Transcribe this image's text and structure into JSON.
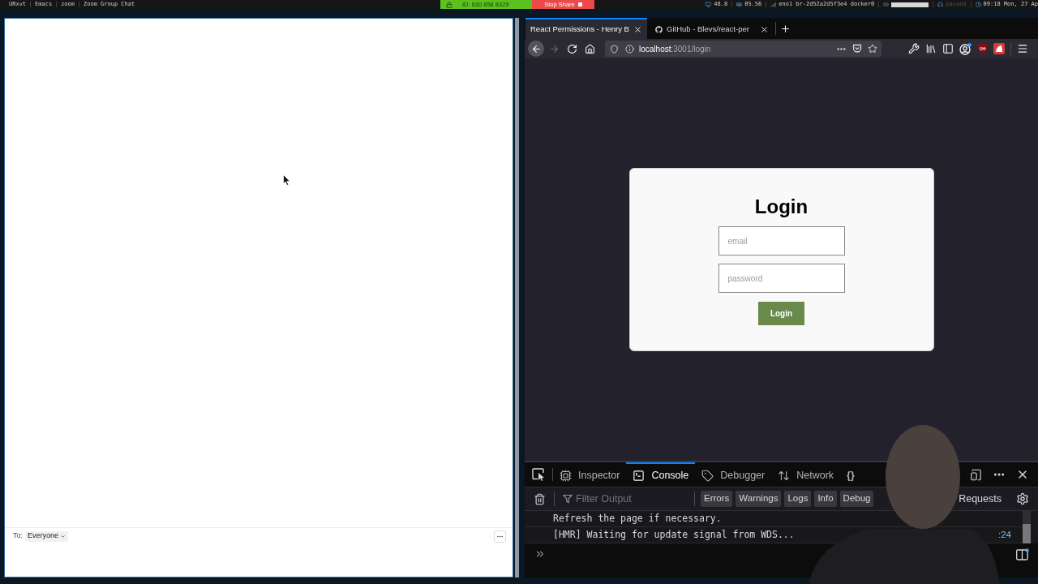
{
  "top_bar": {
    "workspaces": [
      "URxvt",
      "Emacs",
      "zoom",
      "Zoom Group Chat"
    ],
    "meeting_id": "ID: 630 858 8329",
    "stop_share": "Stop Share",
    "status": [
      {
        "kind": "cpu",
        "text": "48.8"
      },
      {
        "kind": "memory",
        "text": "05.56"
      },
      {
        "kind": "network",
        "text": "eno1 br-2d52a2d5f3e4 docker0"
      },
      {
        "kind": "volume",
        "level": 1
      },
      {
        "kind": "music",
        "text": "paused"
      },
      {
        "kind": "clock",
        "text": "09:18 Mon, 27 Ap"
      }
    ]
  },
  "chat_window": {
    "to_label": "To:",
    "recipient": "Everyone"
  },
  "browser": {
    "tabs": [
      {
        "title": "React Permissions - Henry B",
        "favicon": false,
        "selected": true
      },
      {
        "title": "GitHub - Blevs/react-per",
        "favicon": true,
        "selected": false
      }
    ],
    "nav_buttons": [
      {
        "kind": "back",
        "disabled": false
      },
      {
        "kind": "forward",
        "disabled": true
      },
      {
        "kind": "reload",
        "disabled": false
      },
      {
        "kind": "home",
        "disabled": false
      }
    ],
    "url": {
      "host": "localhost",
      "rest": ":3001/login"
    },
    "page": {
      "heading": "Login",
      "fields": [
        {
          "placeholder": "email"
        },
        {
          "placeholder": "password"
        }
      ],
      "button": "Login"
    }
  },
  "devtools": {
    "tabs": [
      {
        "kind": "inspector",
        "label": "Inspector",
        "selected": false
      },
      {
        "kind": "console",
        "label": "Console",
        "selected": true
      },
      {
        "kind": "debugger",
        "label": "Debugger",
        "selected": false
      },
      {
        "kind": "network",
        "label": "Network",
        "selected": false
      },
      {
        "kind": "style_editor",
        "label": "{}",
        "selected": false
      }
    ],
    "filter": {
      "placeholder": "Filter Output"
    },
    "filters": [
      {
        "label": "Errors",
        "selected": true
      },
      {
        "label": "Warnings",
        "selected": true
      },
      {
        "label": "Logs",
        "selected": true
      },
      {
        "label": "Info",
        "selected": true
      },
      {
        "label": "Debug",
        "selected": true
      },
      {
        "label": "Requests",
        "selected": false
      }
    ],
    "messages": [
      {
        "text": "Refresh the page if necessary."
      },
      {
        "text": "[HMR] Waiting for update signal from WDS...",
        "source": ":24"
      }
    ]
  }
}
